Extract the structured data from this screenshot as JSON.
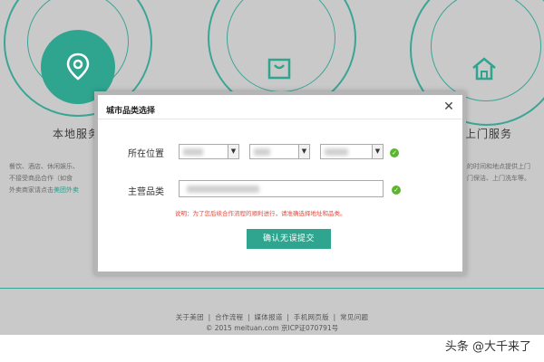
{
  "categories": [
    {
      "title": "本地服务",
      "icon": "map-pin-icon"
    },
    {
      "title": "",
      "icon": "shopping-bag-icon"
    },
    {
      "title": "上门服务",
      "icon": "home-icon"
    }
  ],
  "left_desc": {
    "line1": "餐饮、酒店、休闲娱乐、",
    "line2": "不接受商品合作（如食",
    "line3_prefix": "外卖商家请点击",
    "line3_link": "美团外卖"
  },
  "right_desc": {
    "line1": "的时间和地点提供上门",
    "line2": "门保洁、上门洗车等。"
  },
  "footer": {
    "links": [
      "关于美团",
      "|",
      "合作流程",
      "|",
      "媒体报道",
      "|",
      "手机网页版",
      "|",
      "常见问题"
    ],
    "copyright": "© 2015 meituan.com 京ICP证070791号"
  },
  "watermark": "头条 @大千来了",
  "modal": {
    "title": "城市品类选择",
    "close_symbol": "✕",
    "location_label": "所在位置",
    "category_label": "主营品类",
    "notice": "说明：为了您后续合作流程的顺利进行，请准确选择地址和品类。",
    "submit_label": "确认无误提交"
  },
  "colors": {
    "accent": "#2fa590",
    "ring": "#3aa595",
    "notice": "#e24a3b",
    "check": "#5cb531",
    "page_background": "#c9c9c9"
  }
}
